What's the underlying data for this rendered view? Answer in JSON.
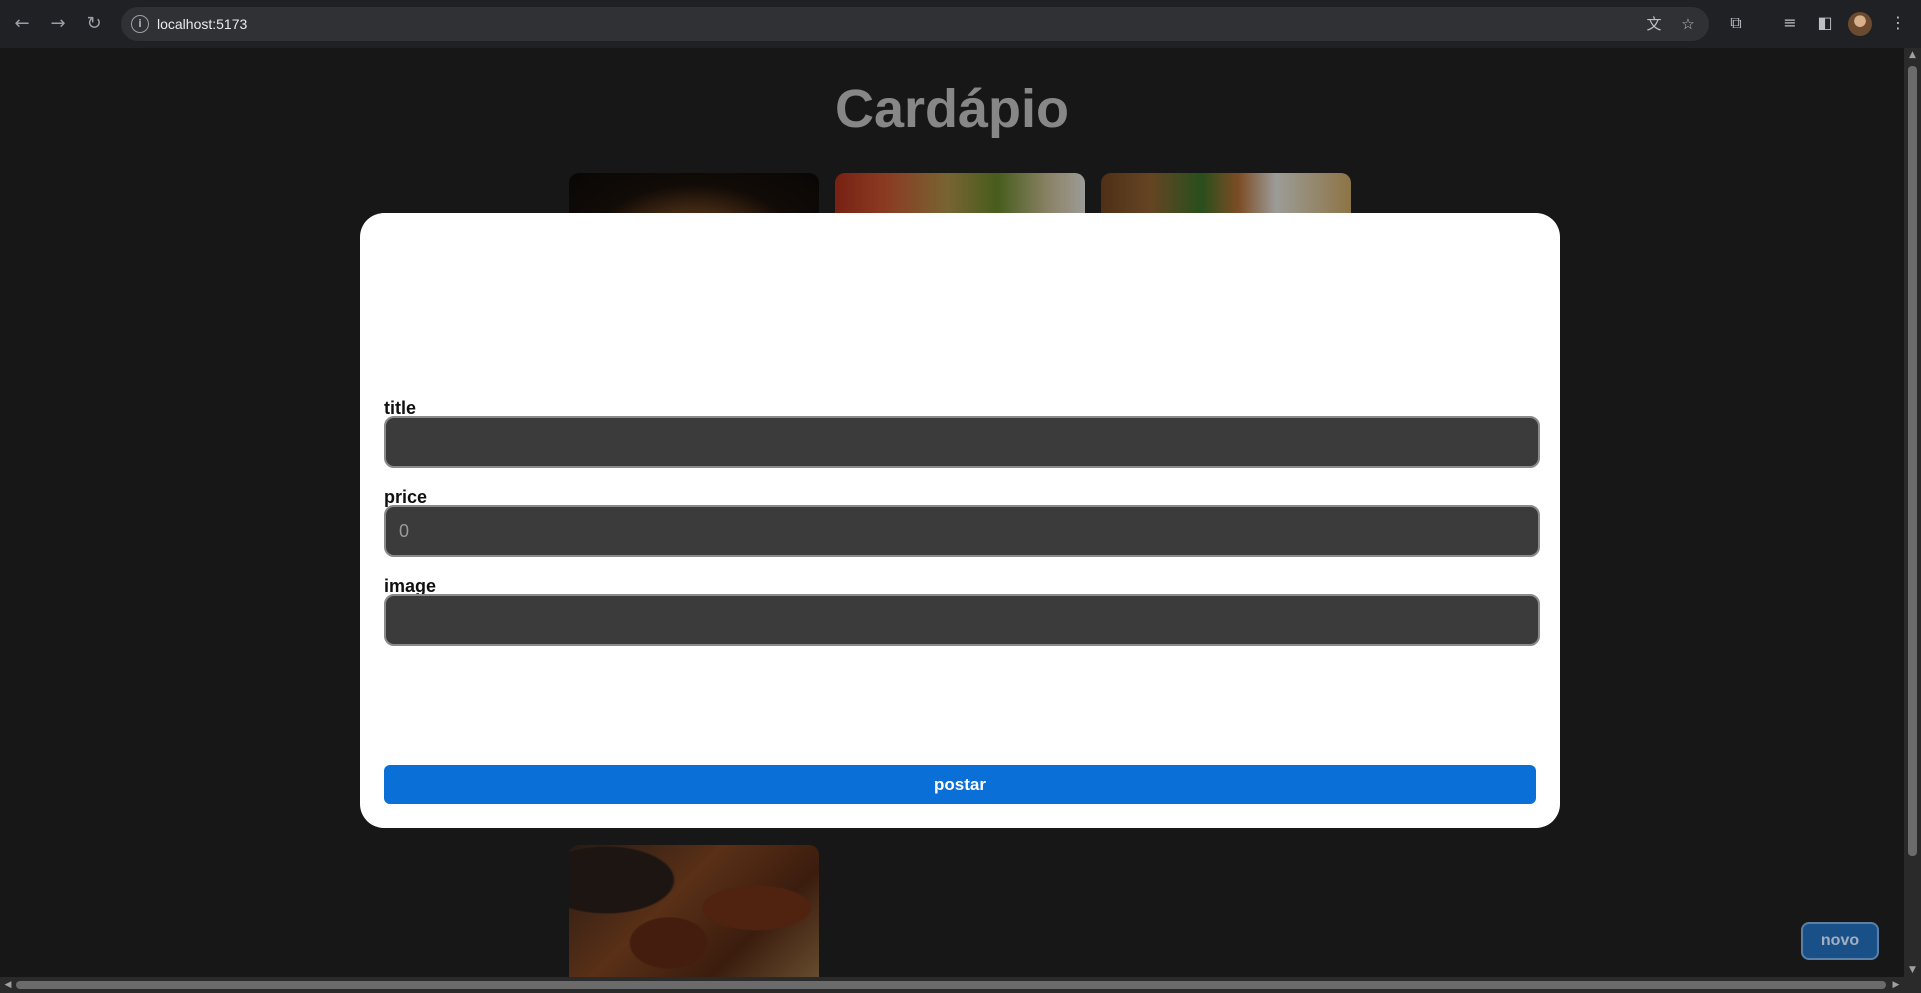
{
  "browser": {
    "url": "localhost:5173",
    "icons": {
      "back": "arrow-left-icon",
      "forward": "arrow-right-icon",
      "reload": "reload-icon",
      "site_info": "info-icon",
      "translate": "translate-icon",
      "bookmark": "star-icon",
      "extensions": "puzzle-icon",
      "media": "media-queue-icon",
      "side_panel": "side-panel-icon",
      "profile": "avatar",
      "menu": "more-vert-icon"
    }
  },
  "page": {
    "title": "Cardápio",
    "novo_label": "novo"
  },
  "modal": {
    "fields": [
      {
        "label": "title",
        "value": ""
      },
      {
        "label": "price",
        "value": "0"
      },
      {
        "label": "image",
        "value": ""
      }
    ],
    "submit_label": "postar"
  },
  "colors": {
    "page_bg": "#242424",
    "modal_bg": "#ffffff",
    "input_bg": "#3b3b3b",
    "primary": "#0a6fd6"
  }
}
